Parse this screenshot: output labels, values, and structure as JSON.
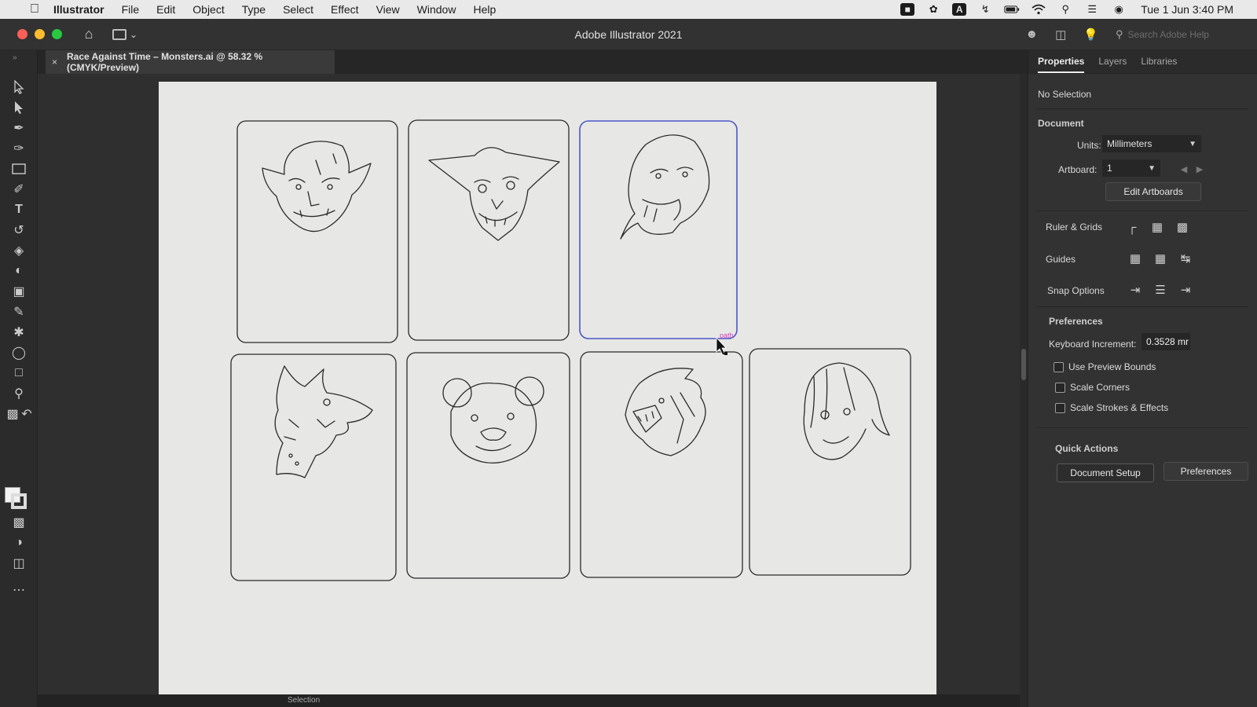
{
  "menubar": {
    "app_name": "Illustrator",
    "items": [
      "File",
      "Edit",
      "Object",
      "Type",
      "Select",
      "Effect",
      "View",
      "Window",
      "Help"
    ],
    "clock": "Tue 1 Jun  3:40 PM"
  },
  "appbar": {
    "title": "Adobe Illustrator 2021",
    "search_placeholder": "Search Adobe Help"
  },
  "document_tab": {
    "close": "×",
    "title": "Race Against Time – Monsters.ai @ 58.32 % (CMYK/Preview)"
  },
  "canvas": {
    "hover_label": "path",
    "status_mode": "Selection"
  },
  "panel": {
    "tabs": [
      "Properties",
      "Layers",
      "Libraries"
    ],
    "active_tab": "Properties",
    "no_selection": "No Selection",
    "document_header": "Document",
    "units_label": "Units:",
    "units_value": "Millimeters",
    "artboard_label": "Artboard:",
    "artboard_value": "1",
    "edit_artboards": "Edit Artboards",
    "rulers_grids": "Ruler & Grids",
    "guides": "Guides",
    "snap_options": "Snap Options",
    "preferences_header": "Preferences",
    "keyboard_increment_label": "Keyboard Increment:",
    "keyboard_increment_value": "0.3528 mr",
    "checkboxes": [
      "Use Preview Bounds",
      "Scale Corners",
      "Scale Strokes & Effects"
    ],
    "quick_actions": "Quick Actions",
    "document_setup": "Document Setup",
    "preferences_button": "Preferences"
  },
  "colors": {
    "selected_card_outline": "#4a56c8",
    "hover_label": "#d63cbf",
    "close_red": "#fe5f57",
    "minimize_yellow": "#febc2e",
    "zoom_green": "#28c840"
  },
  "cards": {
    "count": 7,
    "selected_index": 2,
    "monsters": [
      "orc-head",
      "goblin-head",
      "ghoul-head",
      "dragon-head",
      "bear-head",
      "sea-serpent-head",
      "zombie-girl-head"
    ]
  }
}
